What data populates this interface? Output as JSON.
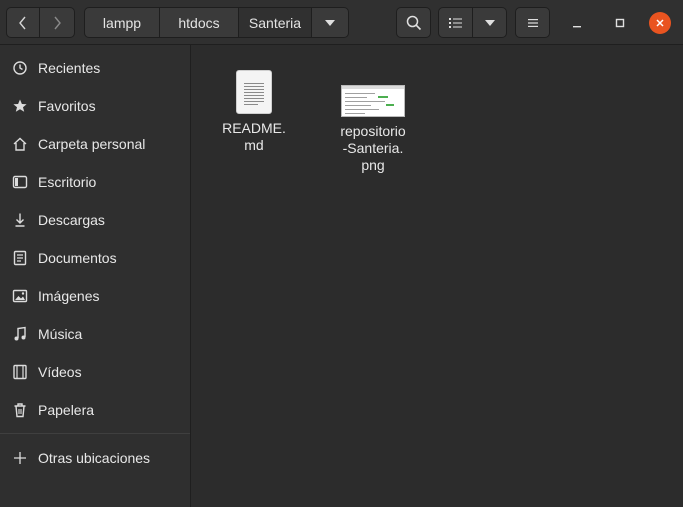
{
  "breadcrumb": {
    "items": [
      "lampp",
      "htdocs",
      "Santeria"
    ]
  },
  "sidebar": {
    "items": [
      {
        "label": "Recientes",
        "icon": "recent-icon"
      },
      {
        "label": "Favoritos",
        "icon": "star-icon"
      },
      {
        "label": "Carpeta personal",
        "icon": "home-icon"
      },
      {
        "label": "Escritorio",
        "icon": "desktop-icon"
      },
      {
        "label": "Descargas",
        "icon": "download-icon"
      },
      {
        "label": "Documentos",
        "icon": "document-icon"
      },
      {
        "label": "Imágenes",
        "icon": "image-icon"
      },
      {
        "label": "Música",
        "icon": "music-icon"
      },
      {
        "label": "Vídeos",
        "icon": "video-icon"
      },
      {
        "label": "Papelera",
        "icon": "trash-icon"
      }
    ],
    "other": {
      "label": "Otras ubicaciones",
      "icon": "plus-icon"
    }
  },
  "files": [
    {
      "name_line1": "README.",
      "name_line2": "md",
      "name_line3": "",
      "type": "text-document"
    },
    {
      "name_line1": "repositorio",
      "name_line2": "-Santeria.",
      "name_line3": "png",
      "type": "image-thumbnail"
    }
  ],
  "colors": {
    "accent_close": "#e95420",
    "background": "#2c2c2c",
    "sidebar": "#2f2f2f"
  }
}
